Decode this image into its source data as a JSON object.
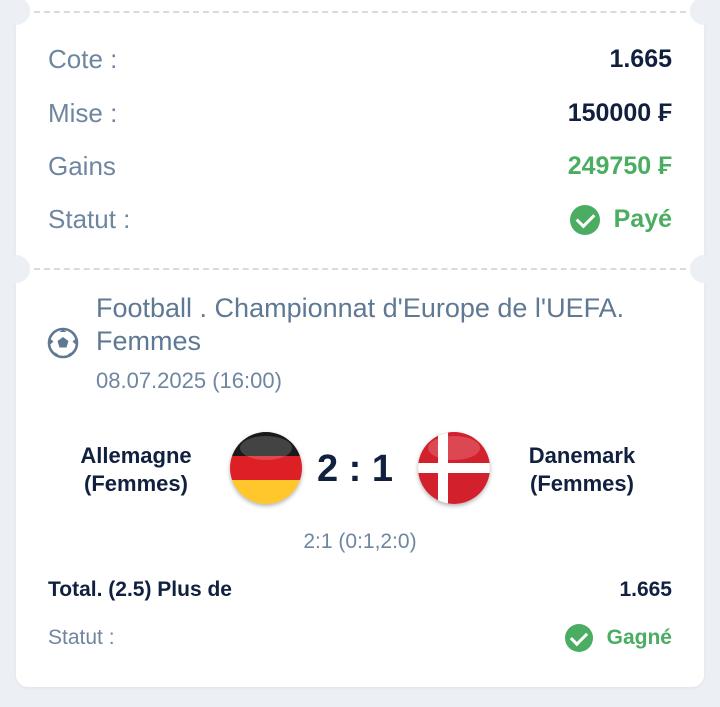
{
  "summary": {
    "odds_label": "Cote :",
    "odds_value": "1.665",
    "stake_label": "Mise :",
    "stake_value": "150000 ₣",
    "winnings_label": "Gains",
    "winnings_value": "249750 ₣",
    "status_label": "Statut :",
    "status_value": "Payé"
  },
  "event": {
    "league": "Football . Championnat d'Europe de l'UEFA. Femmes",
    "datetime": "08.07.2025 (16:00)",
    "home_team_line1": "Allemagne",
    "home_team_line2": "(Femmes)",
    "away_team_line1": "Danemark",
    "away_team_line2": "(Femmes)",
    "score": "2 : 1",
    "score_detail": "2:1 (0:1,2:0)",
    "home_flag": "germany-flag",
    "away_flag": "denmark-flag"
  },
  "bet": {
    "market": "Total. (2.5) Plus de",
    "odds": "1.665",
    "status_label": "Statut :",
    "status_value": "Gagné"
  },
  "colors": {
    "accent_green": "#4aad62",
    "text_dark": "#10203e",
    "text_muted": "#6f86a0",
    "background": "#eceff3"
  }
}
